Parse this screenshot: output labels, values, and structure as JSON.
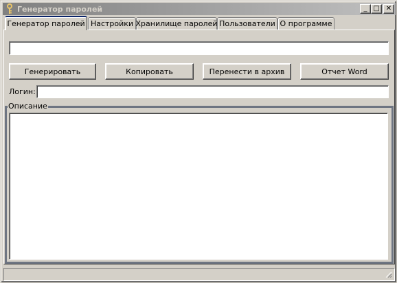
{
  "window": {
    "title": "Генератор паролей",
    "title_icon": "key-icon"
  },
  "titlebar_buttons": {
    "minimize": "_",
    "maximize": "□",
    "close": "✕"
  },
  "tabs": [
    {
      "label": "Генератор паролей",
      "active": true
    },
    {
      "label": "Настройки",
      "active": false
    },
    {
      "label": "Хранилище паролей",
      "active": false
    },
    {
      "label": "Пользователи",
      "active": false
    },
    {
      "label": "О программе",
      "active": false
    }
  ],
  "generator": {
    "password_value": "",
    "buttons": {
      "generate": "Генерировать",
      "copy": "Копировать",
      "archive": "Перенести в архив",
      "word_report": "Отчет Word"
    },
    "login_label": "Логин:",
    "login_value": "",
    "description_label": "Описание",
    "description_value": ""
  },
  "statusbar": {
    "text": ""
  }
}
